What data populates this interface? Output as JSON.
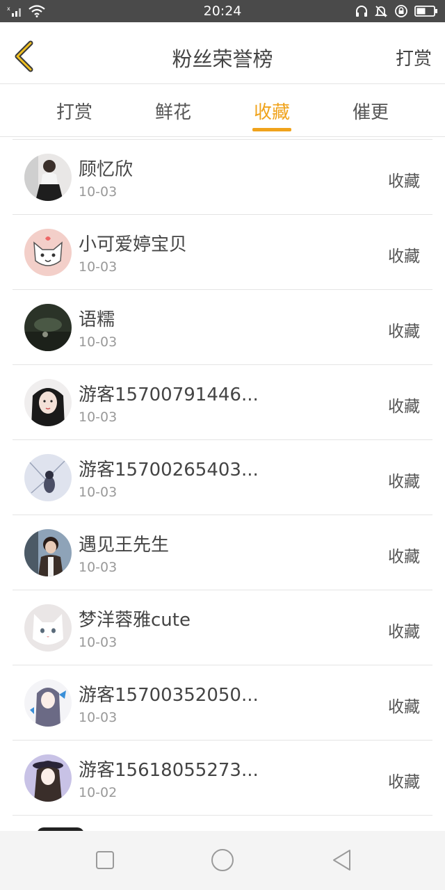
{
  "status_bar": {
    "time": "20:24",
    "icons": [
      "signal-icon",
      "wifi-icon",
      "headphones-icon",
      "bell-off-icon",
      "rotation-lock-icon",
      "battery-icon"
    ]
  },
  "header": {
    "title": "粉丝荣誉榜",
    "action_label": "打赏",
    "back_icon": "chevron-left-icon"
  },
  "tabs": [
    {
      "label": "打赏",
      "active": false
    },
    {
      "label": "鲜花",
      "active": false
    },
    {
      "label": "收藏",
      "active": true
    },
    {
      "label": "催更",
      "active": false
    }
  ],
  "colors": {
    "accent": "#f0a31c",
    "status_bar": "#4a4a4a",
    "divider": "#e4e4e4",
    "nav_bar": "#f4f4f4"
  },
  "fans": [
    {
      "name": "顾忆欣",
      "date": "10-03",
      "tag": "收藏",
      "avatar": "girl-photo"
    },
    {
      "name": "小可爱婷宝贝",
      "date": "10-03",
      "tag": "收藏",
      "avatar": "cartoon-cat"
    },
    {
      "name": "语糯",
      "date": "10-03",
      "tag": "收藏",
      "avatar": "dark-scene"
    },
    {
      "name": "游客15700791446...",
      "date": "10-03",
      "tag": "收藏",
      "avatar": "girl-portrait"
    },
    {
      "name": "游客15700265403...",
      "date": "10-03",
      "tag": "收藏",
      "avatar": "snow-scene"
    },
    {
      "name": "遇见王先生",
      "date": "10-03",
      "tag": "收藏",
      "avatar": "boy-photo"
    },
    {
      "name": "梦洋蓉雅cute",
      "date": "10-03",
      "tag": "收藏",
      "avatar": "white-cat"
    },
    {
      "name": "游客15700352050...",
      "date": "10-03",
      "tag": "收藏",
      "avatar": "anime-girl"
    },
    {
      "name": "游客15618055273...",
      "date": "10-02",
      "tag": "收藏",
      "avatar": "anime-girl-hat"
    }
  ],
  "nav_bar": {
    "buttons": [
      "recent-apps-icon",
      "home-icon",
      "back-icon"
    ]
  }
}
